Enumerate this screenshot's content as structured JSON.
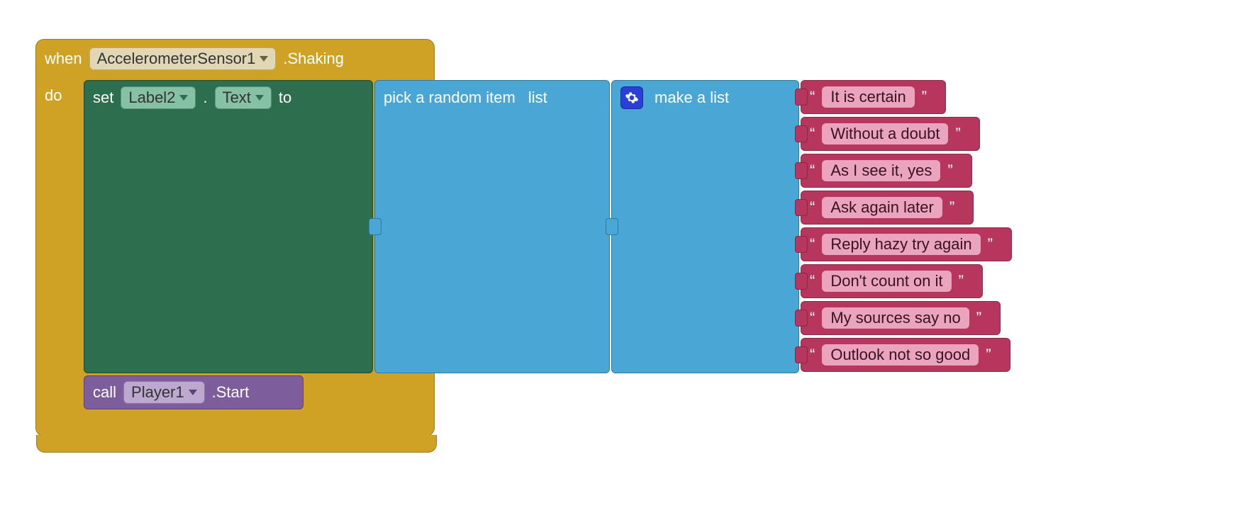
{
  "event": {
    "when": "when",
    "component": "AccelerometerSensor1",
    "eventName": ".Shaking",
    "do": "do"
  },
  "setter": {
    "set": "set",
    "component": "Label2",
    "dot": ".",
    "property": "Text",
    "to": "to"
  },
  "randomItem": {
    "label": "pick a random item",
    "slot": "list"
  },
  "makeList": {
    "label": "make a list"
  },
  "strings": [
    "It is certain",
    "Without a doubt",
    "As I see it, yes",
    "Ask again later",
    "Reply hazy try again",
    "Don't count on it",
    "My sources say no",
    "Outlook not so good"
  ],
  "caller": {
    "call": "call",
    "component": "Player1",
    "method": ".Start"
  },
  "quote": "“",
  "endquote": "”"
}
